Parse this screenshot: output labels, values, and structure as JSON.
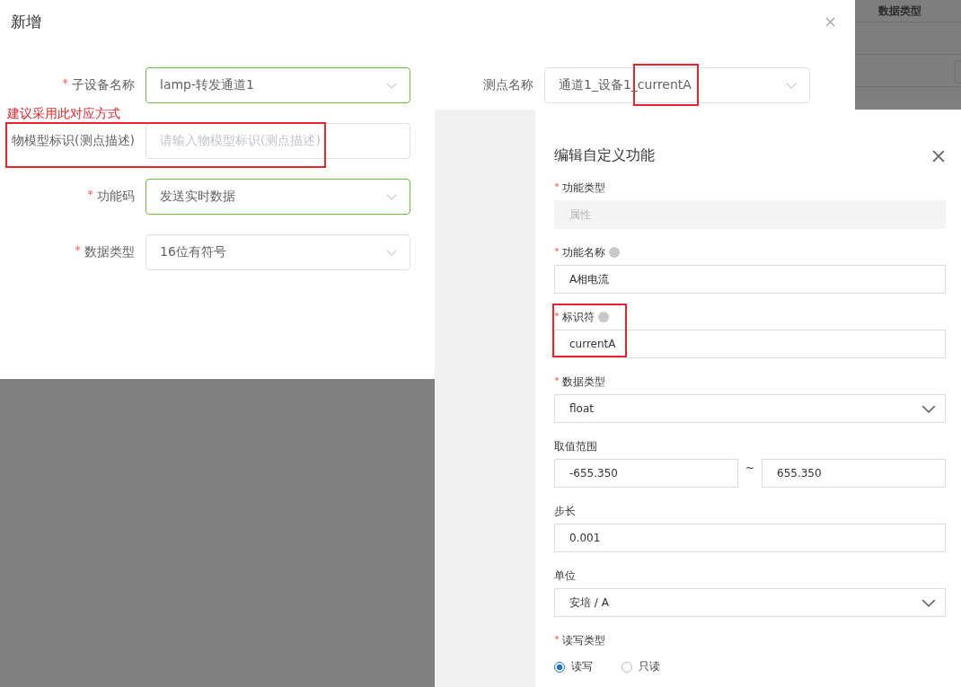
{
  "background_table": {
    "columns": [
      "数据类型"
    ]
  },
  "add_dialog": {
    "title": "新增",
    "left_fields": [
      {
        "label": "子设备名称",
        "required": true,
        "kind": "select",
        "value": "lamp-转发通道1",
        "validated": true
      },
      {
        "label": "物模型标识(测点描述)",
        "required": false,
        "kind": "input",
        "placeholder": "请输入物模型标识(测点描述)",
        "validated": false
      },
      {
        "label": "功能码",
        "required": true,
        "kind": "select",
        "value": "发送实时数据",
        "validated": true
      },
      {
        "label": "数据类型",
        "required": true,
        "kind": "select",
        "value": "16位有符号",
        "validated": false
      }
    ],
    "right_fields": [
      {
        "label": "测点名称",
        "required": false,
        "kind": "select",
        "value": "通道1_设备1_currentA",
        "validated": false
      }
    ]
  },
  "annotation": {
    "note": "建议采用此对应方式"
  },
  "edit_panel": {
    "title": "编辑自定义功能",
    "fields": [
      {
        "label": "功能类型",
        "required": true,
        "help": false,
        "kind": "input",
        "value": "属性",
        "disabled": true
      },
      {
        "label": "功能名称",
        "required": true,
        "help": true,
        "kind": "input",
        "value": "A相电流",
        "disabled": false
      },
      {
        "label": "标识符",
        "required": true,
        "help": true,
        "kind": "input",
        "value": "currentA",
        "disabled": false
      },
      {
        "label": "数据类型",
        "required": true,
        "help": false,
        "kind": "select",
        "value": "float",
        "disabled": false
      },
      {
        "label": "取值范围",
        "required": false,
        "help": false,
        "kind": "range",
        "min": "-655.350",
        "separator": "~",
        "max": "655.350",
        "disabled": false
      },
      {
        "label": "步长",
        "required": false,
        "help": false,
        "kind": "input",
        "value": "0.001",
        "disabled": false
      },
      {
        "label": "单位",
        "required": false,
        "help": false,
        "kind": "select",
        "value": "安培 / A",
        "disabled": false
      },
      {
        "label": "读写类型",
        "required": true,
        "help": false,
        "kind": "radio",
        "options": [
          {
            "label": "读写",
            "selected": true
          },
          {
            "label": "只读",
            "selected": false
          }
        ],
        "disabled": false
      }
    ]
  }
}
